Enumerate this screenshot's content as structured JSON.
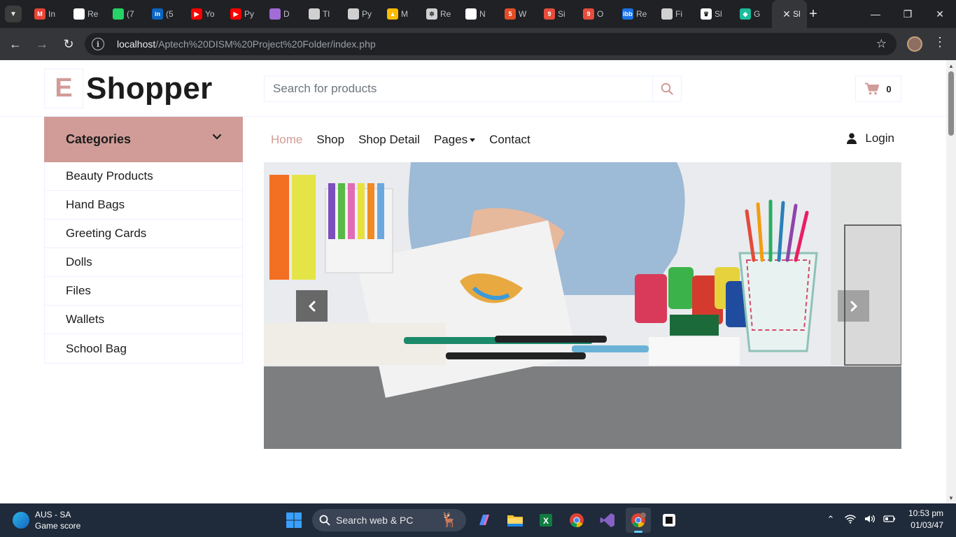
{
  "browser": {
    "tabs": [
      {
        "label": "In",
        "icon": "gmail-icon",
        "color": "#ea4335",
        "glyph": "M"
      },
      {
        "label": "Re",
        "icon": "github-icon",
        "color": "#ffffff",
        "glyph": ""
      },
      {
        "label": "(7",
        "icon": "whatsapp-icon",
        "color": "#25d366",
        "glyph": ""
      },
      {
        "label": "(5",
        "icon": "linkedin-icon",
        "color": "#0a66c2",
        "glyph": "in"
      },
      {
        "label": "Yo",
        "icon": "youtube-icon",
        "color": "#ff0000",
        "glyph": "▶"
      },
      {
        "label": "Py",
        "icon": "youtube-icon",
        "color": "#ff0000",
        "glyph": "▶"
      },
      {
        "label": "D",
        "icon": "gemini-icon",
        "color": "#a26bd6",
        "glyph": ""
      },
      {
        "label": "Tl",
        "icon": "chatgpt-icon",
        "color": "#d0d0d0",
        "glyph": ""
      },
      {
        "label": "Py",
        "icon": "chatgpt-icon",
        "color": "#d0d0d0",
        "glyph": ""
      },
      {
        "label": "M",
        "icon": "drive-icon",
        "color": "#fbbc04",
        "glyph": "▲"
      },
      {
        "label": "Re",
        "icon": "openai-icon",
        "color": "#d0d0d0",
        "glyph": "✲"
      },
      {
        "label": "N",
        "icon": "github-icon",
        "color": "#ffffff",
        "glyph": ""
      },
      {
        "label": "W",
        "icon": "w3-icon",
        "color": "#e44d26",
        "glyph": "5"
      },
      {
        "label": "Si",
        "icon": "app9-icon",
        "color": "#e74c3c",
        "glyph": "9"
      },
      {
        "label": "O",
        "icon": "app9-icon",
        "color": "#e74c3c",
        "glyph": "9"
      },
      {
        "label": "Re",
        "icon": "imgbb-icon",
        "color": "#1a73e8",
        "glyph": "ibb"
      },
      {
        "label": "Fi",
        "icon": "chatgpt-icon",
        "color": "#d0d0d0",
        "glyph": ""
      },
      {
        "label": "Sl",
        "icon": "crown-icon",
        "color": "#ffffff",
        "glyph": "♛"
      },
      {
        "label": "G",
        "icon": "diamond-icon",
        "color": "#1abc9c",
        "glyph": "◆"
      },
      {
        "label": "Sl",
        "icon": "page-icon",
        "color": "#35363a",
        "glyph": "",
        "active": true
      }
    ],
    "url_host": "localhost",
    "url_path": "/Aptech%20DISM%20Project%20Folder/index.php"
  },
  "header": {
    "logo_letter": "E",
    "logo_text": "Shopper",
    "search_placeholder": "Search for products",
    "cart_count": "0"
  },
  "categories": {
    "title": "Categories",
    "items": [
      "Beauty Products",
      "Hand Bags",
      "Greeting Cards",
      "Dolls",
      "Files",
      "Wallets",
      "School Bag"
    ]
  },
  "nav": {
    "links": [
      "Home",
      "Shop",
      "Shop Detail",
      "Pages",
      "Contact"
    ],
    "active": "Home",
    "login": "Login"
  },
  "colors": {
    "primary": "#d19c97",
    "dark": "#1c1c1c",
    "border": "#edf1ff"
  },
  "taskbar": {
    "weather_title": "AUS - SA",
    "weather_sub": "Game score",
    "search_label": "Search web & PC",
    "time": "10:53 pm",
    "date": "01/03/47"
  }
}
